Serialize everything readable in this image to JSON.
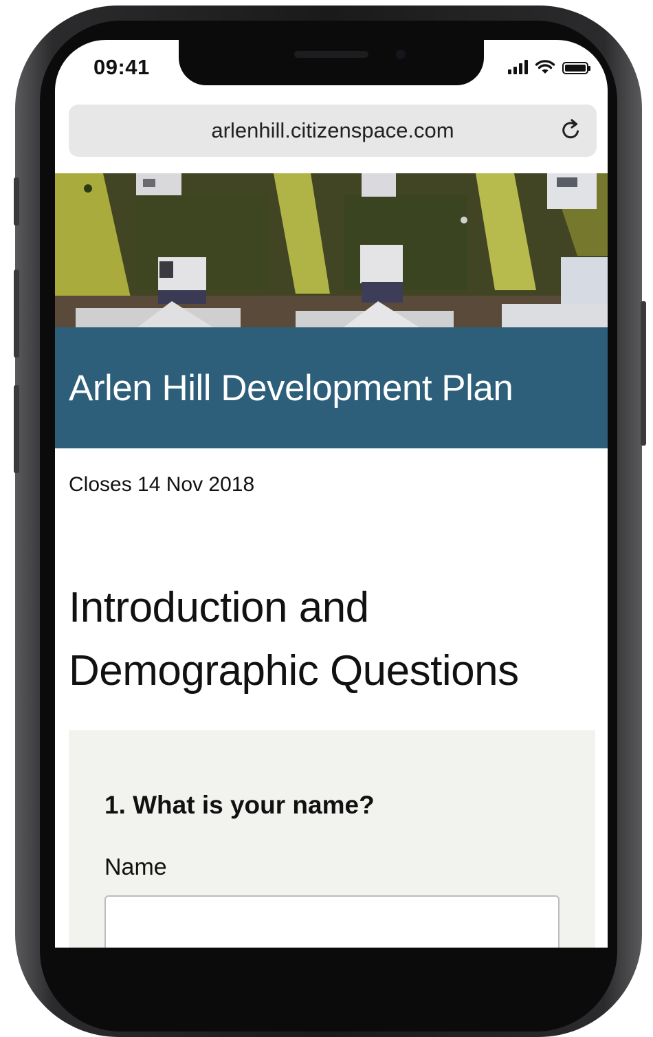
{
  "status_bar": {
    "time": "09:41",
    "battery_level": 1.0
  },
  "browser": {
    "url": "arlenhill.citizenspace.com",
    "reload_icon": "reload-icon"
  },
  "banner": {
    "title": "Arlen Hill Development Plan",
    "background_color": "#2d5f7a"
  },
  "consultation": {
    "closes": "Closes 14 Nov 2018",
    "page_title_line1": "Introduction and",
    "page_title_line2": "Demographic Questions"
  },
  "question": {
    "heading": "1. What is your name?",
    "field_label": "Name",
    "field_value": ""
  }
}
